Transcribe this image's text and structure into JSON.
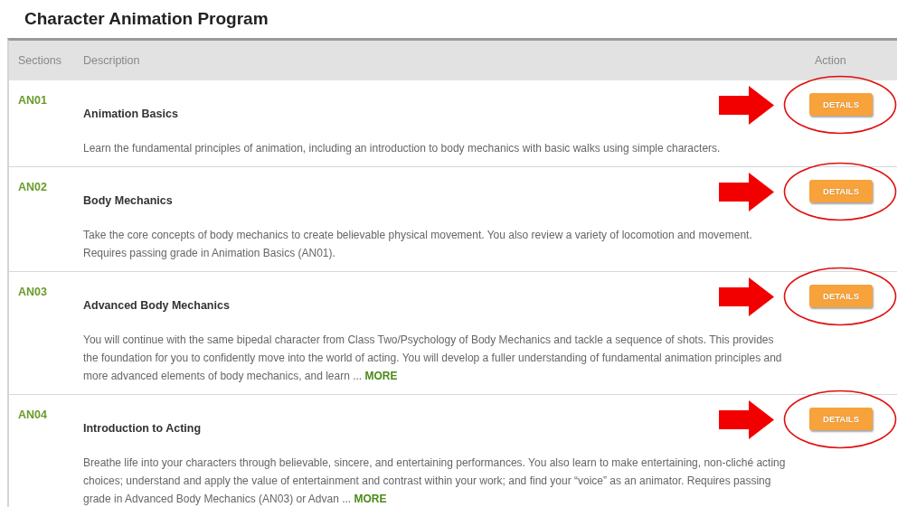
{
  "page": {
    "title": "Character Animation Program"
  },
  "table": {
    "columns": [
      "Sections",
      "Description",
      "Action"
    ],
    "rows": [
      {
        "section": "AN01",
        "title": "Animation Basics",
        "description": "Learn the fundamental principles of animation, including an introduction to body mechanics with basic walks using simple characters.",
        "button": "DETAILS",
        "annotated": true
      },
      {
        "section": "AN02",
        "title": "Body Mechanics",
        "description": "Take the core concepts of body mechanics to create believable physical movement. You also review a variety of locomotion and movement. Requires passing grade in Animation Basics (AN01).",
        "button": "DETAILS",
        "annotated": true
      },
      {
        "section": "AN03",
        "title": "Advanced Body Mechanics",
        "description": "You will continue with the same bipedal character from Class Two/Psychology of Body Mechanics and tackle a sequence of shots. This provides the foundation for you to confidently move into the world of acting. You will develop a fuller understanding of fundamental animation principles and more advanced elements of body mechanics, and learn ...",
        "more_link": "MORE",
        "button": "DETAILS",
        "annotated": true
      },
      {
        "section": "AN04",
        "title": "Introduction to Acting",
        "description": "Breathe life into your characters through believable, sincere, and entertaining performances. You also learn to make entertaining, non-cliché acting choices; understand and apply the value of entertainment and contrast within your work; and find your “voice” as an animator. Requires passing grade in Advanced Body Mechanics (AN03) or Advan ...",
        "more_link": "MORE",
        "button": "DETAILS",
        "annotated": true
      }
    ]
  }
}
